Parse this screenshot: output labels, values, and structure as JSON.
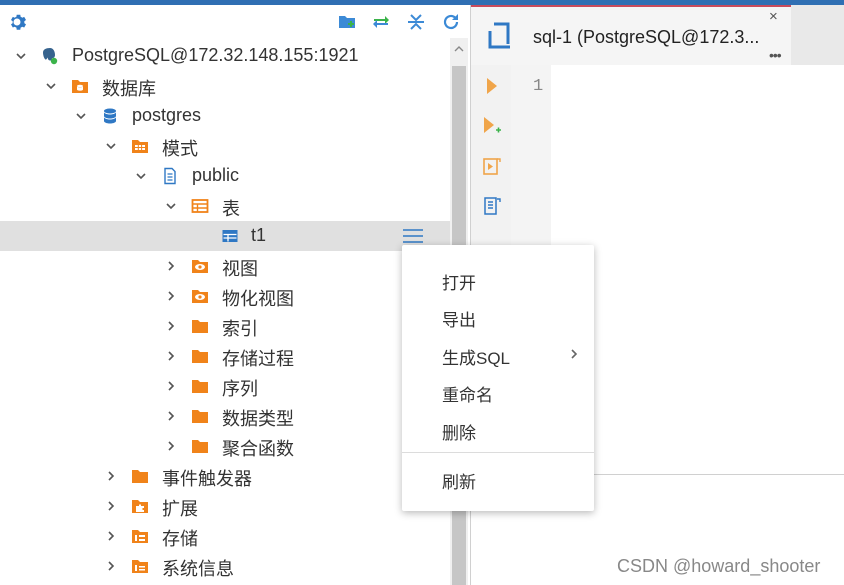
{
  "toolbar": {
    "icons": [
      "gear-icon",
      "new-folder-icon",
      "sync-icon",
      "collapse-icon",
      "refresh-icon"
    ]
  },
  "tree": {
    "items": [
      {
        "label": "PostgreSQL@172.32.148.155:1921",
        "icon": "connection-icon",
        "expanded": true
      },
      {
        "label": "数据库",
        "icon": "database-folder-icon",
        "expanded": true
      },
      {
        "label": "postgres",
        "icon": "database-icon",
        "expanded": true
      },
      {
        "label": "模式",
        "icon": "schema-folder-icon",
        "expanded": true
      },
      {
        "label": "public",
        "icon": "schema-icon",
        "expanded": true
      },
      {
        "label": "表",
        "icon": "table-folder-icon",
        "expanded": true
      },
      {
        "label": "t1",
        "icon": "table-icon",
        "selected": true
      },
      {
        "label": "视图",
        "icon": "view-folder-icon",
        "expanded": false
      },
      {
        "label": "物化视图",
        "icon": "view-folder-icon",
        "expanded": false
      },
      {
        "label": "索引",
        "icon": "folder-icon",
        "expanded": false
      },
      {
        "label": "存储过程",
        "icon": "folder-icon",
        "expanded": false
      },
      {
        "label": "序列",
        "icon": "folder-icon",
        "expanded": false
      },
      {
        "label": "数据类型",
        "icon": "folder-icon",
        "expanded": false
      },
      {
        "label": "聚合函数",
        "icon": "folder-icon",
        "expanded": false
      },
      {
        "label": "事件触发器",
        "icon": "folder-icon",
        "expanded": false
      },
      {
        "label": "扩展",
        "icon": "extension-icon",
        "expanded": false
      },
      {
        "label": "存储",
        "icon": "storage-icon",
        "expanded": false
      },
      {
        "label": "系统信息",
        "icon": "info-icon",
        "expanded": false
      }
    ]
  },
  "editor": {
    "tab_title": "sql-1 (PostgreSQL@172.3...",
    "tab_close": "×",
    "tab_more": "•••",
    "line_number": "1"
  },
  "context_menu": {
    "items": [
      {
        "label": "打开"
      },
      {
        "label": "导出"
      },
      {
        "label": "生成SQL",
        "submenu": true
      },
      {
        "label": "重命名"
      },
      {
        "label": "删除"
      },
      {
        "label": "刷新"
      }
    ]
  },
  "watermark": "CSDN @howard_shooter",
  "colors": {
    "accent": "#2f6fb3",
    "folder": "#f0831a",
    "tab_border": "#c94b5c",
    "play": "#f0a54a"
  }
}
